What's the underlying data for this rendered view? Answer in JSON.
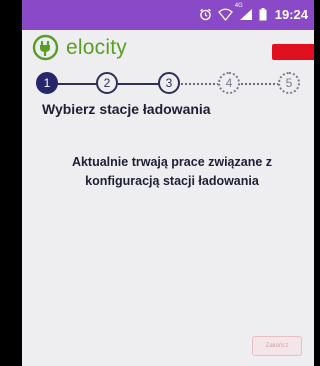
{
  "status_bar": {
    "time": "19:24",
    "network_label": "4G",
    "icons": [
      "alarm-icon",
      "wifi-icon",
      "signal-icon",
      "battery-icon"
    ]
  },
  "app": {
    "name": "elocity",
    "brand_color": "#5a9e26",
    "accent_color": "#8a49c6"
  },
  "stepper": {
    "steps": [
      {
        "label": "1",
        "state": "active"
      },
      {
        "label": "2",
        "state": "done"
      },
      {
        "label": "3",
        "state": "done"
      },
      {
        "label": "4",
        "state": "pending"
      },
      {
        "label": "5",
        "state": "pending"
      }
    ]
  },
  "main": {
    "title": "Wybierz stacje ładowania",
    "message": "Aktualnie trwają prace związane z konfiguracją stacji ładowania"
  },
  "footer": {
    "finish_label": "Zakończ"
  }
}
